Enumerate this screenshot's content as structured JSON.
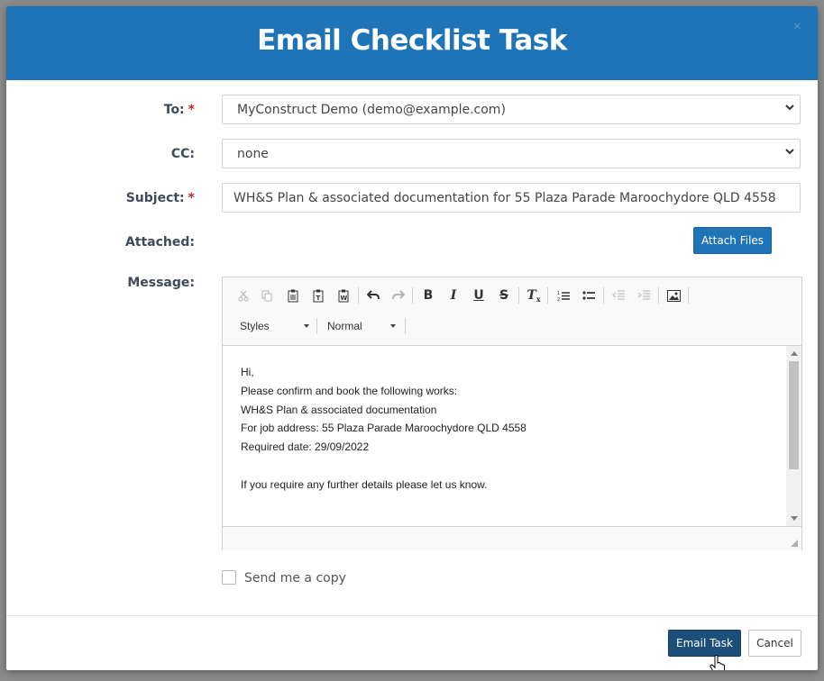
{
  "modal": {
    "title": "Email Checklist Task",
    "close_icon": "×"
  },
  "form": {
    "to": {
      "label": "To:",
      "required": "*",
      "value": "MyConstruct Demo (demo@example.com)"
    },
    "cc": {
      "label": "CC:",
      "value": "none"
    },
    "subject": {
      "label": "Subject:",
      "required": "*",
      "value": "WH&S Plan & associated documentation for 55 Plaza Parade Maroochydore QLD 4558"
    },
    "attached": {
      "label": "Attached:",
      "button": "Attach Files"
    },
    "message": {
      "label": "Message:"
    }
  },
  "editor": {
    "toolbar_icons": [
      "cut-icon",
      "copy-icon",
      "paste-icon",
      "paste-text-icon",
      "paste-word-icon",
      "undo-icon",
      "redo-icon",
      "bold-icon",
      "italic-icon",
      "underline-icon",
      "strikethrough-icon",
      "remove-format-icon",
      "numbered-list-icon",
      "bulleted-list-icon",
      "outdent-icon",
      "indent-icon",
      "image-icon"
    ],
    "styles_combo": "Styles",
    "format_combo": "Normal",
    "lines": [
      "Hi,",
      "Please confirm and book the following works:",
      "WH&S Plan & associated documentation",
      "For job address: 55 Plaza Parade Maroochydore QLD 4558",
      "Required date: 29/09/2022",
      "",
      "If you require any further details please let us know."
    ]
  },
  "send_copy": {
    "label": "Send me a copy",
    "checked": false
  },
  "footer": {
    "email_button": "Email Task",
    "cancel_button": "Cancel"
  },
  "colors": {
    "header": "#1f74b8",
    "primary_button": "#1b4f7a",
    "required": "#c62828"
  }
}
